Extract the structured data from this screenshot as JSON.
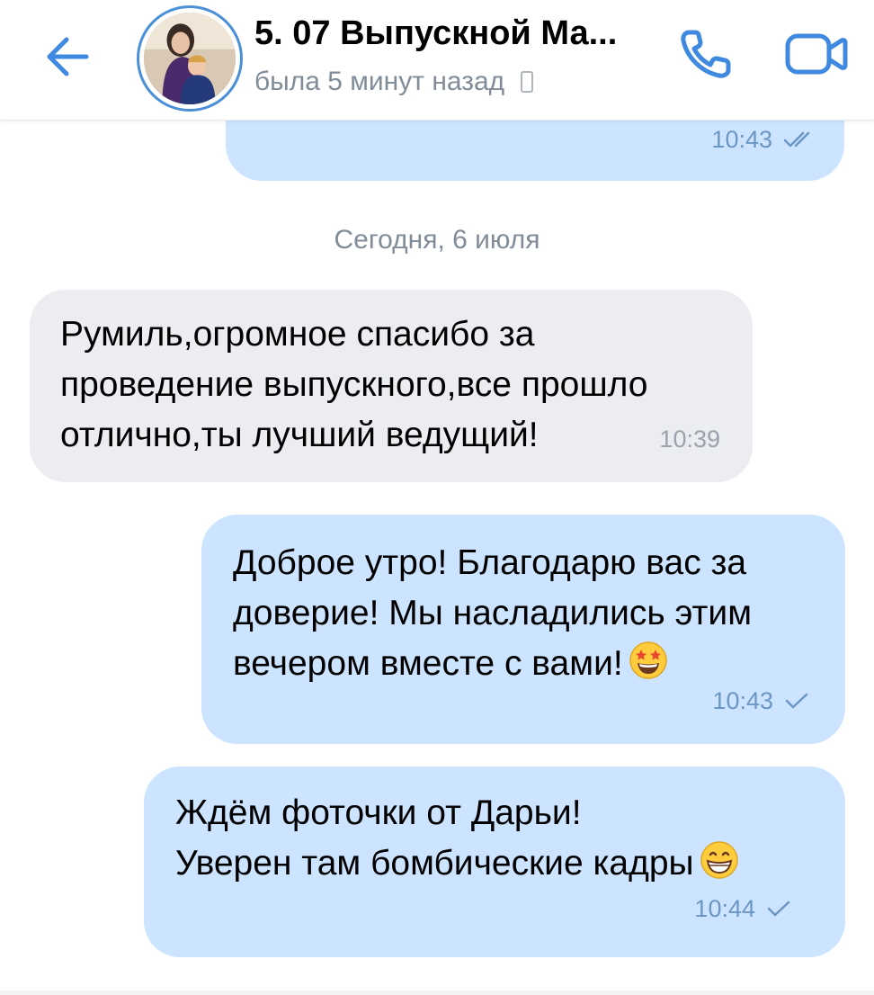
{
  "header": {
    "title": "5. 07 Выпускной Ма...",
    "status": "была 5 минут назад",
    "icons": {
      "back": "arrow-left-icon",
      "call": "phone-icon",
      "video": "video-camera-icon",
      "device": "mobile-device-icon"
    }
  },
  "messages": {
    "previous": {
      "time": "10:43",
      "status": "read"
    },
    "date_separator": "Сегодня, 6 июля",
    "incoming_1": {
      "text": "Румиль,огромное спасибо за\nпроведение выпускного,все прошло\nотлично,ты лучший ведущий!",
      "time": "10:39"
    },
    "outgoing_1": {
      "text": "Доброе утро! Благодарю вас за\nдоверие! Мы насладились этим\nвечером вместе с вами!",
      "emoji": "star-struck-emoji",
      "time": "10:43",
      "status": "sent"
    },
    "outgoing_2": {
      "text": "Ждём фоточки от Дарьи!\nУверен там бомбические кадры",
      "emoji": "grinning-face-emoji",
      "time": "10:44",
      "status": "sent"
    }
  },
  "colors": {
    "accent": "#3f8ae0",
    "outgoing_bubble": "#cce4ff",
    "incoming_bubble": "#ebedf0",
    "secondary_text": "#818c99"
  }
}
